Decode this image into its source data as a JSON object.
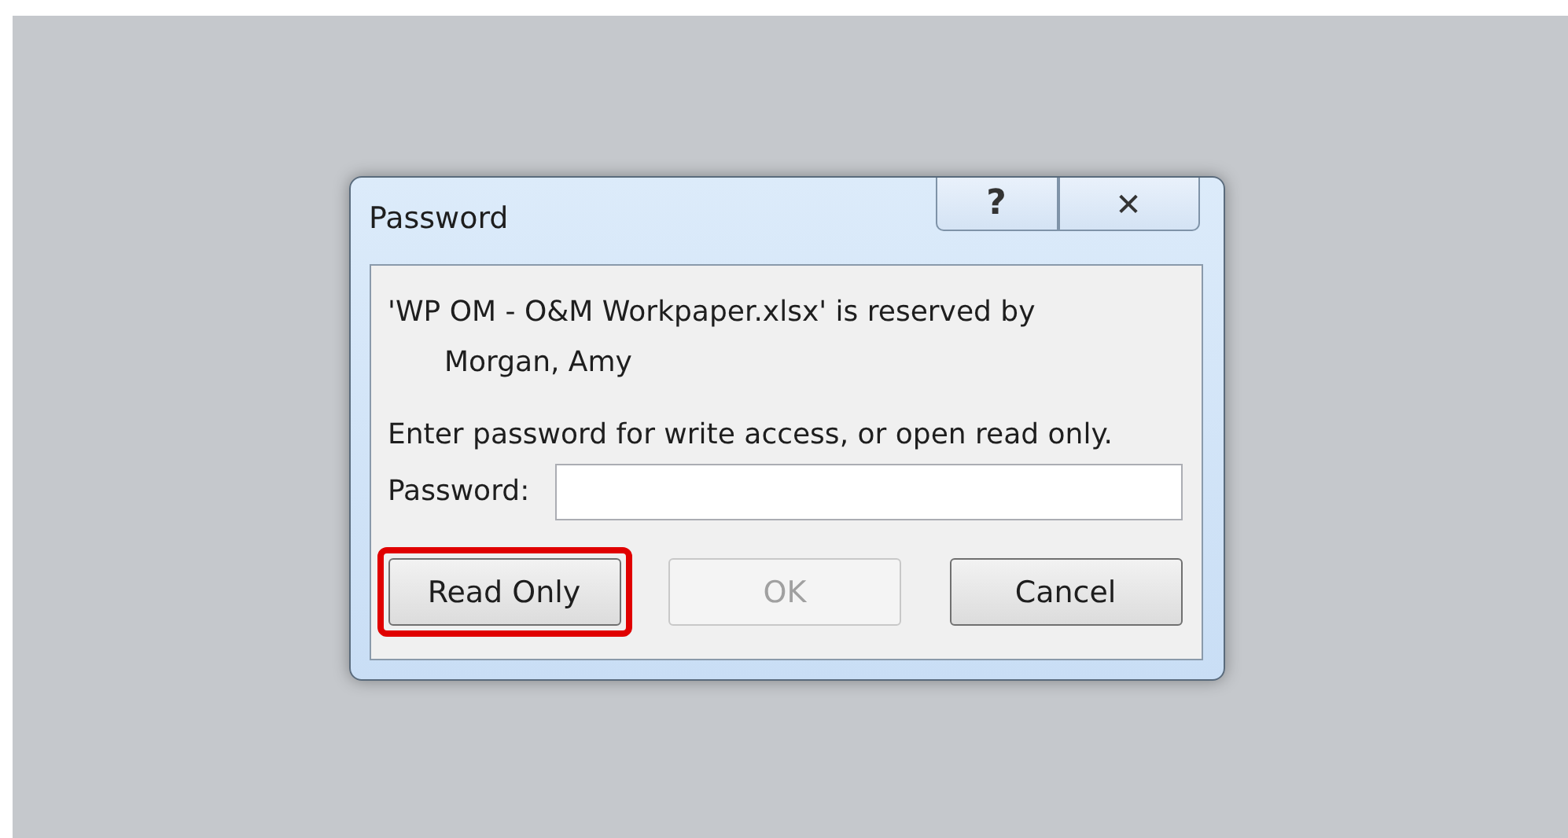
{
  "window": {
    "title": "Password",
    "title_buttons": [
      {
        "kind": "help",
        "label": "?"
      },
      {
        "kind": "close",
        "label": "✕"
      }
    ]
  },
  "message": {
    "line_1": "'WP OM - O&M Workpaper.xlsx' is reserved by",
    "line_2": "Morgan, Amy"
  },
  "prompt": "Enter password for write access, or open read only.",
  "password_field": {
    "label": "Password:"
  },
  "buttons": [
    {
      "label": "Read Only",
      "disabled": false,
      "highlighted": true
    },
    {
      "label": "OK",
      "disabled": true,
      "highlighted": false
    },
    {
      "label": "Cancel",
      "disabled": false,
      "highlighted": false
    }
  ]
}
